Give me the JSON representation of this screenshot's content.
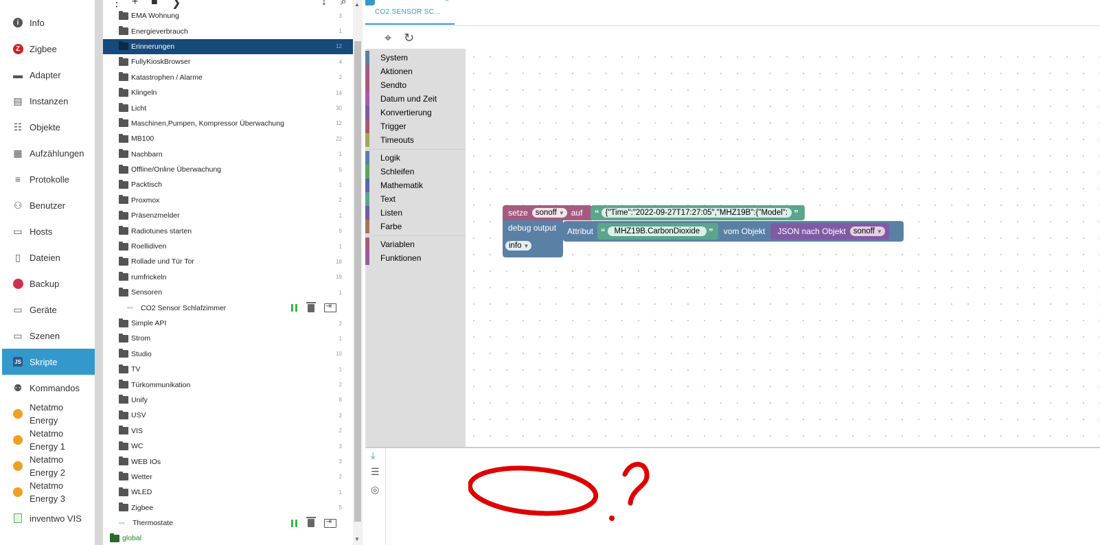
{
  "nav": {
    "items": [
      {
        "label": "Info",
        "icon": "info-icon"
      },
      {
        "label": "Zigbee",
        "icon": "zigbee-icon"
      },
      {
        "label": "Adapter",
        "icon": "adapter-icon"
      },
      {
        "label": "Instanzen",
        "icon": "instances-icon"
      },
      {
        "label": "Objekte",
        "icon": "objects-icon"
      },
      {
        "label": "Aufzählungen",
        "icon": "enums-icon"
      },
      {
        "label": "Protokolle",
        "icon": "logs-icon"
      },
      {
        "label": "Benutzer",
        "icon": "user-icon"
      },
      {
        "label": "Hosts",
        "icon": "hosts-icon"
      },
      {
        "label": "Dateien",
        "icon": "files-icon"
      },
      {
        "label": "Backup",
        "icon": "backup-icon"
      },
      {
        "label": "Geräte",
        "icon": "devices-icon"
      },
      {
        "label": "Szenen",
        "icon": "scenes-icon"
      },
      {
        "label": "Skripte",
        "icon": "scripts-icon",
        "active": true
      },
      {
        "label": "Kommandos",
        "icon": "commands-icon"
      },
      {
        "label": "Netatmo Energy",
        "icon": "netatmo-icon"
      },
      {
        "label": "Netatmo Energy 1",
        "icon": "netatmo-icon"
      },
      {
        "label": "Netatmo Energy 2",
        "icon": "netatmo-icon"
      },
      {
        "label": "Netatmo Energy 3",
        "icon": "netatmo-icon"
      },
      {
        "label": "inventwo VIS",
        "icon": "inventwo-icon"
      }
    ]
  },
  "tree": {
    "rows": [
      {
        "type": "folder",
        "label": "EMA Wohnung",
        "count": "3"
      },
      {
        "type": "folder",
        "label": "Energieverbrauch",
        "count": "1"
      },
      {
        "type": "folder",
        "label": "Erinnerungen",
        "count": "12",
        "selected": true
      },
      {
        "type": "folder",
        "label": "FullyKioskBrowser",
        "count": "4"
      },
      {
        "type": "folder",
        "label": "Katastrophen / Alarme",
        "count": "2"
      },
      {
        "type": "folder",
        "label": "Klingeln",
        "count": "14"
      },
      {
        "type": "folder",
        "label": "Licht",
        "count": "30"
      },
      {
        "type": "folder",
        "label": "Maschinen,Pumpen, Kompressor Überwachung",
        "count": "12"
      },
      {
        "type": "folder",
        "label": "MB100",
        "count": "22"
      },
      {
        "type": "folder",
        "label": "Nachbarn",
        "count": "1"
      },
      {
        "type": "folder",
        "label": "Offline/Online Überwachung",
        "count": "5"
      },
      {
        "type": "folder",
        "label": "Packtisch",
        "count": "1"
      },
      {
        "type": "folder",
        "label": "Proxmox",
        "count": "2"
      },
      {
        "type": "folder",
        "label": "Präsenzmelder",
        "count": "1"
      },
      {
        "type": "folder",
        "label": "Radiotunes starten",
        "count": "5"
      },
      {
        "type": "folder",
        "label": "Roellidiven",
        "count": "1"
      },
      {
        "type": "folder",
        "label": "Rollade und Tür Tor",
        "count": "18"
      },
      {
        "type": "folder",
        "label": "rumfrickeln",
        "count": "19"
      },
      {
        "type": "folder-open",
        "label": "Sensoren",
        "count": "1"
      },
      {
        "type": "script",
        "label": "CO2 Sensor Schlafzimmer",
        "icon_text": "Blockly",
        "nested": true
      },
      {
        "type": "folder",
        "label": "Simple API",
        "count": "2"
      },
      {
        "type": "folder",
        "label": "Strom",
        "count": "1"
      },
      {
        "type": "folder",
        "label": "Studio",
        "count": "10"
      },
      {
        "type": "folder",
        "label": "TV",
        "count": "1"
      },
      {
        "type": "folder",
        "label": "Türkommunikation",
        "count": "2"
      },
      {
        "type": "folder",
        "label": "Unify",
        "count": "8"
      },
      {
        "type": "folder",
        "label": "USV",
        "count": "2"
      },
      {
        "type": "folder",
        "label": "VIS",
        "count": "2"
      },
      {
        "type": "folder",
        "label": "WC",
        "count": "3"
      },
      {
        "type": "folder",
        "label": "WEB IOs",
        "count": "3"
      },
      {
        "type": "folder",
        "label": "Wetter",
        "count": "2"
      },
      {
        "type": "folder",
        "label": "WLED",
        "count": "1"
      },
      {
        "type": "folder",
        "label": "Zigbee",
        "count": "5"
      },
      {
        "type": "script",
        "label": "Thermostate",
        "icon_text": "Blockly",
        "nested": false
      },
      {
        "type": "global",
        "label": "global",
        "count": ""
      }
    ]
  },
  "editor": {
    "tab_label": "CO2 SENSOR SC...",
    "tab_close": "×",
    "toolbox": {
      "groups": [
        [
          {
            "label": "System",
            "color": "#5b80a5"
          },
          {
            "label": "Aktionen",
            "color": "#a55b80"
          },
          {
            "label": "Sendto",
            "color": "#a55b80"
          },
          {
            "label": "Datum und Zeit",
            "color": "#a55ba5"
          },
          {
            "label": "Konvertierung",
            "color": "#805ba5"
          },
          {
            "label": "Trigger",
            "color": "#a5596d"
          },
          {
            "label": "Timeouts",
            "color": "#a5a55b"
          }
        ],
        [
          {
            "label": "Logik",
            "color": "#5b80a5"
          },
          {
            "label": "Schleifen",
            "color": "#5ba55b"
          },
          {
            "label": "Mathematik",
            "color": "#5b67a5"
          },
          {
            "label": "Text",
            "color": "#5ba58c"
          },
          {
            "label": "Listen",
            "color": "#745ba5"
          },
          {
            "label": "Farbe",
            "color": "#a5745b"
          }
        ],
        [
          {
            "label": "Variablen",
            "color": "#a55b80"
          },
          {
            "label": "Funktionen",
            "color": "#995ba5"
          }
        ]
      ]
    },
    "blocks": {
      "set": {
        "label_set": "setze",
        "var": "sonoff",
        "label_to": "auf",
        "text_value": "{\"Time\":\"2022-09-27T17:27:05\",\"MHZ19B\":{\"Model\":"
      },
      "debug": {
        "label": "debug output",
        "level": "info"
      },
      "attr": {
        "label": "Attribut",
        "text_value": "MHZ19B.CarbonDioxide",
        "label_from": "vom Objekt"
      },
      "json": {
        "label": "JSON nach Objekt",
        "var": "sonoff"
      }
    },
    "colors": {
      "variables": "#a55b80",
      "text": "#5ba58c",
      "debug": "#5b80a5",
      "json": "#805ba5",
      "accent": "#3399cc"
    }
  },
  "annotation": {
    "text": "0?",
    "color": "#e00000"
  }
}
